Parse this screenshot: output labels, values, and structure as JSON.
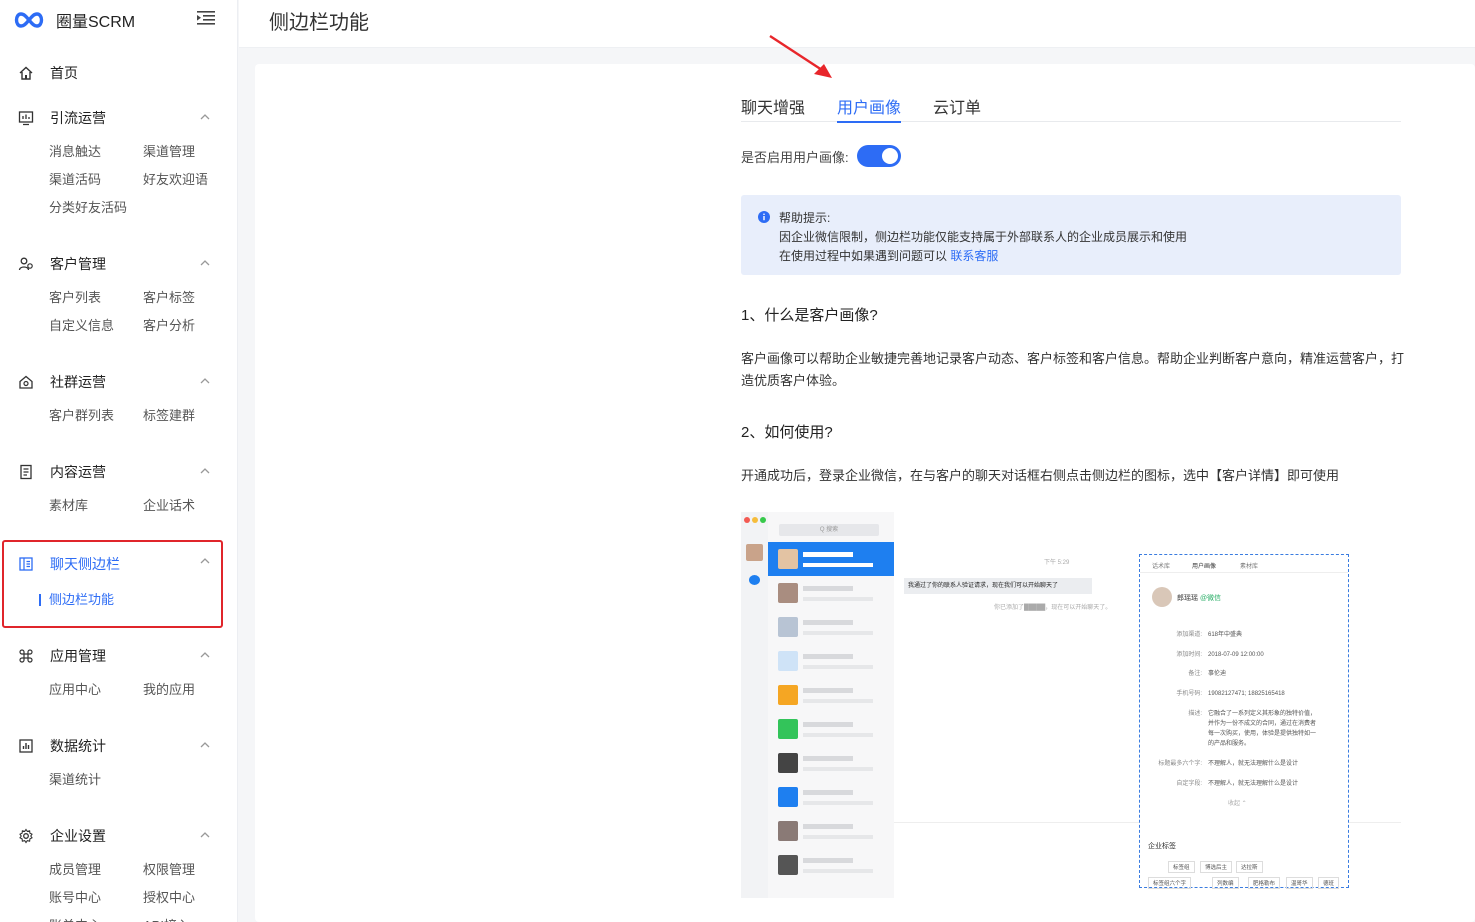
{
  "app": {
    "name": "圈量SCRM"
  },
  "nav": {
    "home": "首页",
    "sections": [
      {
        "title": "引流运营",
        "items": [
          "消息触达",
          "渠道管理",
          "渠道活码",
          "好友欢迎语",
          "分类好友活码"
        ]
      },
      {
        "title": "客户管理",
        "items": [
          "客户列表",
          "客户标签",
          "自定义信息",
          "客户分析"
        ]
      },
      {
        "title": "社群运营",
        "items": [
          "客户群列表",
          "标签建群"
        ]
      },
      {
        "title": "内容运营",
        "items": [
          "素材库",
          "企业话术"
        ]
      },
      {
        "title": "聊天侧边栏",
        "items": [
          "侧边栏功能"
        ]
      },
      {
        "title": "应用管理",
        "items": [
          "应用中心",
          "我的应用"
        ]
      },
      {
        "title": "数据统计",
        "items": [
          "渠道统计"
        ]
      },
      {
        "title": "企业设置",
        "items": [
          "成员管理",
          "权限管理",
          "账号中心",
          "授权中心",
          "账单中心",
          "API接入"
        ]
      }
    ]
  },
  "page": {
    "title": "侧边栏功能",
    "tabs": [
      "聊天增强",
      "用户画像",
      "云订单"
    ],
    "toggle_label": "是否启用用户画像:",
    "help": {
      "title": "帮助提示:",
      "line1": "因企业微信限制，侧边栏功能仅能支持属于外部联系人的企业成员展示和使用",
      "line2": "在使用过程中如果遇到问题可以 ",
      "link": "联系客服"
    },
    "q1": "1、什么是客户画像?",
    "a1": "客户画像可以帮助企业敏捷完善地记录客户动态、客户标签和客户信息。帮助企业判断客户意向，精准运营客户，打造优质客户体验。",
    "q2": "2、如何使用?",
    "a2": "开通成功后，登录企业微信，在与客户的聊天对话框右侧点击侧边栏的图标，选中【客户详情】即可使用"
  },
  "shot": {
    "search": "Q 搜索",
    "time": "下午 5:29",
    "bubble": "我通过了你的联系人验证请求，现在我们可以开始聊天了",
    "sysmsg": "你已添加了█████，现在可以开始聊天了。",
    "panel_tabs": [
      "话术库",
      "用户画像",
      "素材库"
    ],
    "name": "郎瑶瑶",
    "wx": "@微信",
    "fields": [
      {
        "k": "添加渠道:",
        "v": "618年中盛典"
      },
      {
        "k": "添加时间:",
        "v": "2018-07-09 12:00:00"
      },
      {
        "k": "备注:",
        "v": "事伦迪"
      },
      {
        "k": "手机号码:",
        "v": "19082127471; 18825165418"
      },
      {
        "k": "描述:",
        "v": "它融合了一系列定义其形象的独特价值，"
      },
      {
        "k": "",
        "v": "并作为一份不成文的合同，通过在消费者"
      },
      {
        "k": "",
        "v": "每一次购买，使用，体验是提供独特如一"
      },
      {
        "k": "",
        "v": "的产品和服务。"
      },
      {
        "k": "标题最多六个字:",
        "v": "不理解人，就无法理解什么是设计"
      },
      {
        "k": "自定字段:",
        "v": "不理解人，就无法理解什么是设计"
      }
    ],
    "collapse": "收起 ⌃",
    "tag_title": "企业标签",
    "tags": [
      "标签组",
      "博选后主",
      "达拉斯",
      "标签组六个字",
      "列数编",
      "肥格勒布",
      "温哥华",
      "德班"
    ]
  }
}
